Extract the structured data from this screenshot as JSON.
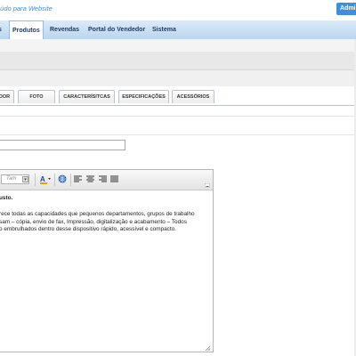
{
  "header": {
    "app_title": "eúdo para Website",
    "admin_label": "Admi"
  },
  "main_nav": {
    "items": [
      {
        "label": "s"
      },
      {
        "label": "Produtos"
      },
      {
        "label": "Revendas"
      },
      {
        "label": "Portal do Vendedor"
      },
      {
        "label": "Sistema"
      }
    ]
  },
  "tabs": [
    {
      "label": "DOR"
    },
    {
      "label": "FOTO"
    },
    {
      "label": "CARACTERÍSITCAS"
    },
    {
      "label": "ESPECIFICAÇÕES"
    },
    {
      "label": "ACESSÓRIOS"
    }
  ],
  "form": {
    "text_input_value": ""
  },
  "editor": {
    "font_size_placeholder": "Tam",
    "heading": "usto.",
    "lines": [
      "rece todas as capacidades que pequenos departamentos, grupos de trabalho",
      "sam – cópia, envio de fax, Impressão, digitalização e acabamento – Todos",
      "o embrulhados dentro desse dispositivo rápido, acessível e compacto."
    ]
  },
  "colors": {
    "accent": "#3d8fe0",
    "nav_bg": "#b9d6f0",
    "title_blue": "#3a8fd8"
  }
}
